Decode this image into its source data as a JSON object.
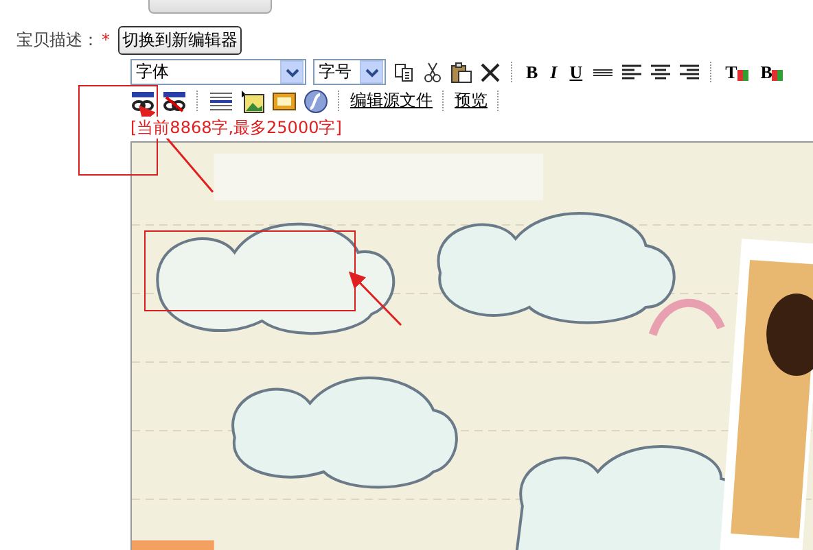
{
  "field_label": "宝贝描述：",
  "required_mark": "*",
  "switch_button": "切换到新编辑器",
  "font_select": {
    "value": "字体"
  },
  "size_select": {
    "value": "字号"
  },
  "format_buttons": [
    {
      "kind": "icon"
    },
    {
      "kind": "icon"
    },
    {
      "kind": "icon"
    },
    {
      "kind": "icon"
    },
    {
      "kind": "sep"
    },
    {
      "kind": "text",
      "label": "B"
    },
    {
      "kind": "text",
      "label": "I"
    },
    {
      "kind": "text",
      "label": "U"
    },
    {
      "kind": "icon"
    },
    {
      "kind": "icon"
    },
    {
      "kind": "icon"
    },
    {
      "kind": "icon"
    },
    {
      "kind": "sep"
    },
    {
      "kind": "text",
      "label": "T"
    },
    {
      "kind": "text",
      "label": "B"
    }
  ],
  "insert_buttons": [
    {
      "kind": "icon"
    },
    {
      "kind": "icon"
    },
    {
      "kind": "sep"
    },
    {
      "kind": "icon"
    },
    {
      "kind": "icon"
    },
    {
      "kind": "icon"
    },
    {
      "kind": "icon"
    },
    {
      "kind": "sep"
    },
    {
      "kind": "link",
      "label": "编辑源文件"
    },
    {
      "kind": "sep"
    },
    {
      "kind": "link",
      "label": "预览"
    },
    {
      "kind": "sep"
    }
  ],
  "counter": "[当前8868字,最多25000字]"
}
